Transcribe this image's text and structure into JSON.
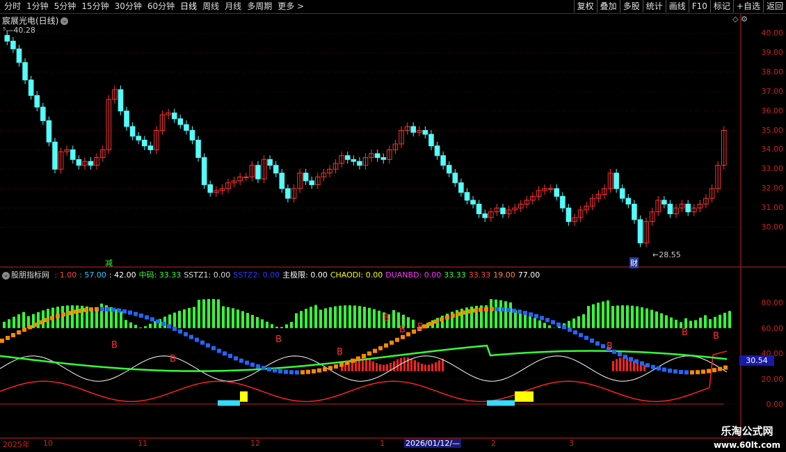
{
  "toolbar": {
    "periods": [
      "分时",
      "1分钟",
      "5分钟",
      "15分钟",
      "30分钟",
      "60分钟",
      "日线",
      "周线",
      "月线",
      "多周期",
      "更多 >"
    ],
    "active_period": "日线",
    "buttons": [
      "复权",
      "叠加",
      "多股",
      "统计",
      "画线",
      "F10",
      "标记",
      "+自选",
      "返回"
    ]
  },
  "main_panel": {
    "title": "宸展光电(日线)",
    "high_marker": "40.28",
    "low_marker": "←28.55",
    "y_labels": [
      "40.00",
      "39.00",
      "38.00",
      "37.00",
      "36.00",
      "35.00",
      "34.00",
      "33.00",
      "32.00",
      "31.00",
      "30.00"
    ],
    "event_markers": [
      "减",
      "财"
    ]
  },
  "indicator_panel": {
    "name": "股朋指标网",
    "params": [
      {
        "text": "1.00",
        "color": "#ff4444"
      },
      {
        "text": "57.00",
        "color": "#33ccff"
      },
      {
        "text": "42.00",
        "color": "#ffffff"
      },
      {
        "text": "中码: 33.33",
        "color": "#33ff33"
      },
      {
        "text": "SSTZ1: 0.00",
        "color": "#dddddd"
      },
      {
        "text": "SSTZ2: 0.00",
        "color": "#3333ff"
      },
      {
        "text": "主极限: 0.00",
        "color": "#ffffff"
      },
      {
        "text": "CHAODI: 0.00",
        "color": "#ffff00"
      },
      {
        "text": "DUANBD: 0.00",
        "color": "#ff33ff"
      },
      {
        "text": "33.33",
        "color": "#33ff33"
      },
      {
        "text": "33.33",
        "color": "#ff4444"
      },
      {
        "text": "19.00",
        "color": "#ff8844"
      },
      {
        "text": "77.00",
        "color": "#ffffff"
      }
    ],
    "y_labels": [
      "80.00",
      "60.00",
      "40.00",
      "20.00",
      "0.00"
    ],
    "current_value": "30.54"
  },
  "date_axis": [
    "2025年",
    "10",
    "11",
    "12",
    "1",
    "2026/01/12/—",
    "2",
    "3"
  ],
  "watermark": {
    "line1": "乐淘公式网",
    "line2": "www.60lt.com"
  }
}
